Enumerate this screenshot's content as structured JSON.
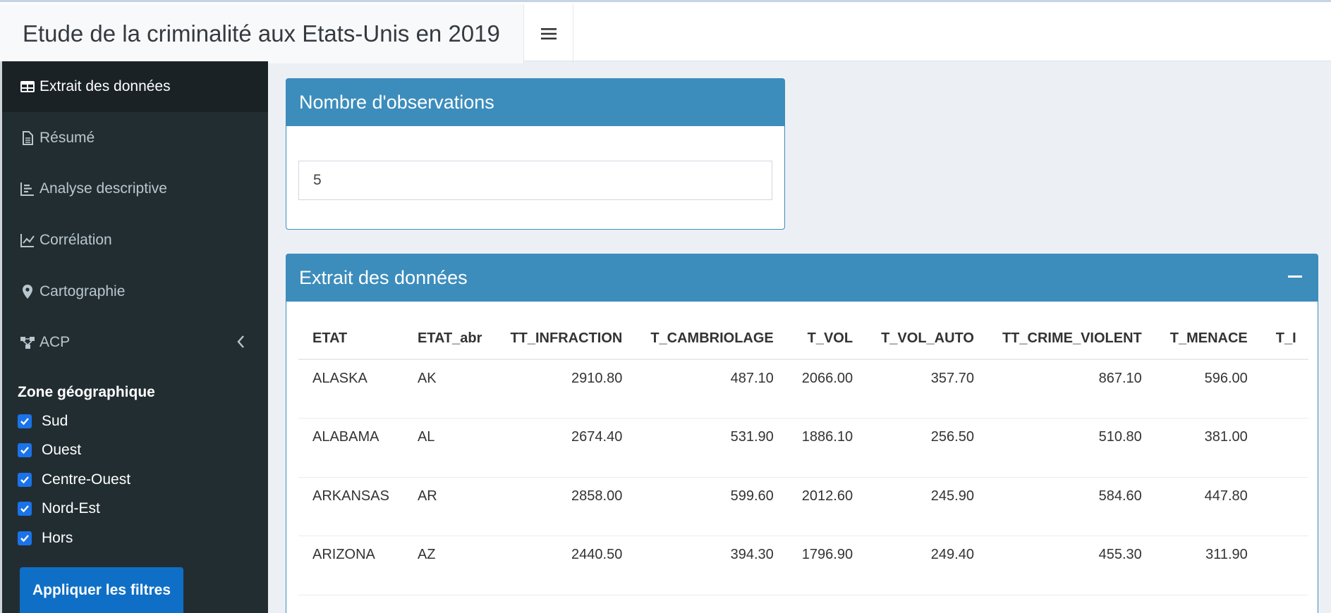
{
  "app": {
    "title": "Etude de la criminalité aux Etats-Unis en 2019"
  },
  "sidebar": {
    "items": [
      {
        "label": "Extrait des données",
        "icon": "table-icon"
      },
      {
        "label": "Résumé",
        "icon": "file-icon"
      },
      {
        "label": "Analyse descriptive",
        "icon": "bar-chart-icon"
      },
      {
        "label": "Corrélation",
        "icon": "line-chart-icon"
      },
      {
        "label": "Cartographie",
        "icon": "map-marker-icon"
      },
      {
        "label": "ACP",
        "icon": "sitemap-icon"
      }
    ],
    "zone_title": "Zone géographique",
    "zones": [
      {
        "label": "Sud",
        "checked": true
      },
      {
        "label": "Ouest",
        "checked": true
      },
      {
        "label": "Centre-Ouest",
        "checked": true
      },
      {
        "label": "Nord-Est",
        "checked": true
      },
      {
        "label": "Hors",
        "checked": true
      }
    ],
    "apply_label": "Appliquer les filtres"
  },
  "obs_box": {
    "title": "Nombre d'observations",
    "value": "5"
  },
  "data_box": {
    "title": "Extrait des données",
    "columns": [
      "ETAT",
      "ETAT_abr",
      "TT_INFRACTION",
      "T_CAMBRIOLAGE",
      "T_VOL",
      "T_VOL_AUTO",
      "TT_CRIME_VIOLENT",
      "T_MENACE",
      "T_I"
    ],
    "rows": [
      [
        "ALASKA",
        "AK",
        "2910.80",
        "487.10",
        "2066.00",
        "357.70",
        "867.10",
        "596.00",
        ""
      ],
      [
        "ALABAMA",
        "AL",
        "2674.40",
        "531.90",
        "1886.10",
        "256.50",
        "510.80",
        "381.00",
        ""
      ],
      [
        "ARKANSAS",
        "AR",
        "2858.00",
        "599.60",
        "2012.60",
        "245.90",
        "584.60",
        "447.80",
        ""
      ],
      [
        "ARIZONA",
        "AZ",
        "2440.50",
        "394.30",
        "1796.90",
        "249.40",
        "455.30",
        "311.90",
        ""
      ]
    ]
  },
  "colors": {
    "box_header": "#3c8dbc",
    "sidebar_bg": "#222d32",
    "checkbox": "#1a73e8",
    "button": "#0f6fc6"
  }
}
